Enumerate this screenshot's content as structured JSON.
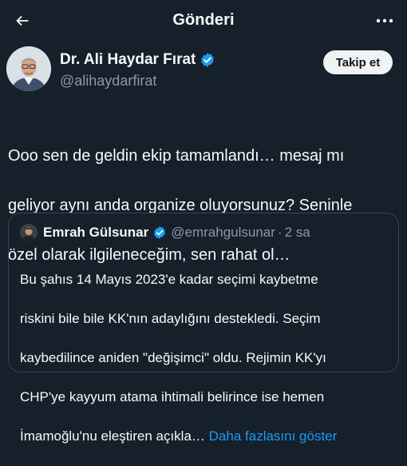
{
  "header": {
    "title": "Gönderi",
    "back_icon": "arrow-left-icon",
    "more_icon": "more-horizontal-icon"
  },
  "author": {
    "name": "Dr. Ali Haydar Fırat",
    "handle": "@alihaydarfirat",
    "verified_icon": "verified-badge-icon",
    "follow_label": "Takip et"
  },
  "tweet": {
    "lines": [
      "Ooo sen de geldin ekip tamamlandı… mesaj mı",
      "geliyor aynı anda organize oluyorsunuz? Seninle",
      "özel olarak ilgileneceğim, sen rahat ol…"
    ]
  },
  "quote": {
    "name": "Emrah Gülsunar",
    "handle": "@emrahgulsunar",
    "dot": "·",
    "time": "2 sa",
    "lines": [
      "Bu şahıs 14 Mayıs 2023'e kadar seçimi kaybetme",
      "riskini bile bile KK'nın adaylığını destekledi. Seçim",
      "kaybedilince aniden \"değişimci\" oldu. Rejimin KK'yı",
      "CHP'ye kayyum atama ihtimali belirince ise hemen",
      "İmamoğlu'nu eleştiren açıkla…"
    ],
    "show_more": "Daha fazlasını göster"
  },
  "colors": {
    "background": "#15202b",
    "text": "#f7f9f9",
    "secondary": "#8b98a5",
    "accent": "#1d9bf0",
    "border": "#38444d"
  }
}
